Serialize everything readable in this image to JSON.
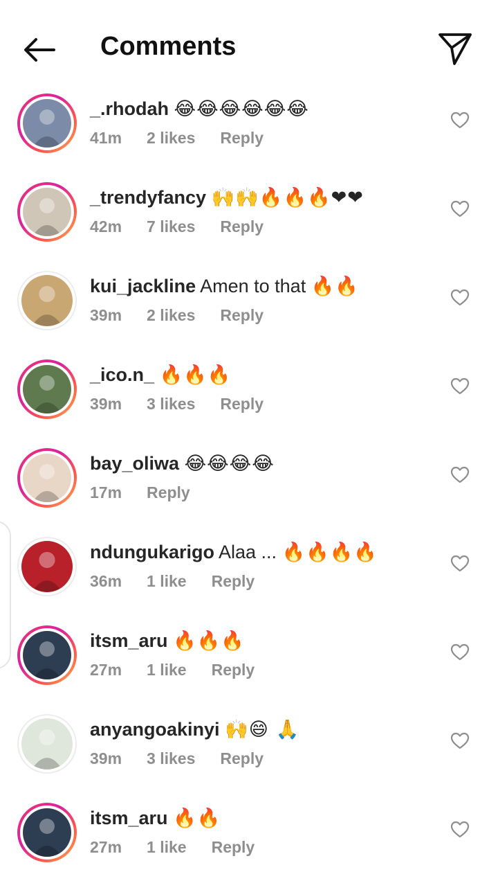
{
  "header": {
    "title": "Comments"
  },
  "comments": [
    {
      "username": "_.rhodah",
      "text": "",
      "emoji": "😂😂😂😂😂😂",
      "time": "41m",
      "likes": "2 likes",
      "reply": "Reply",
      "avatar_color": "#7b8ba8",
      "story_ring": true
    },
    {
      "username": "_trendyfancy",
      "text": "",
      "emoji": "🙌🙌🔥🔥🔥❤❤",
      "time": "42m",
      "likes": "7 likes",
      "reply": "Reply",
      "avatar_color": "#cfc6b8",
      "story_ring": true
    },
    {
      "username": "kui_jackline",
      "text": "Amen to that",
      "emoji": "🔥🔥",
      "time": "39m",
      "likes": "2 likes",
      "reply": "Reply",
      "avatar_color": "#c9a773",
      "story_ring": false
    },
    {
      "username": "_ico.n_",
      "text": "",
      "emoji": "🔥🔥🔥",
      "time": "39m",
      "likes": "3 likes",
      "reply": "Reply",
      "avatar_color": "#5f7a4e",
      "story_ring": true
    },
    {
      "username": "bay_oliwa",
      "text": "",
      "emoji": "😂😂😂😂",
      "time": "17m",
      "likes": "",
      "reply": "Reply",
      "avatar_color": "#e8d6c6",
      "story_ring": true
    },
    {
      "username": "ndungukarigo",
      "text": "Alaa ...",
      "emoji": "🔥🔥🔥🔥",
      "time": "36m",
      "likes": "1 like",
      "reply": "Reply",
      "avatar_color": "#b8202a",
      "story_ring": false
    },
    {
      "username": "itsm_aru",
      "text": "",
      "emoji": "🔥🔥🔥",
      "time": "27m",
      "likes": "1 like",
      "reply": "Reply",
      "avatar_color": "#2d3d52",
      "story_ring": true
    },
    {
      "username": "anyangoakinyi",
      "text": "",
      "emoji": "🙌😄 🙏",
      "time": "39m",
      "likes": "3 likes",
      "reply": "Reply",
      "avatar_color": "#dfe6dc",
      "story_ring": false
    },
    {
      "username": "itsm_aru",
      "text": "",
      "emoji": "🔥🔥",
      "time": "27m",
      "likes": "1 like",
      "reply": "Reply",
      "avatar_color": "#2d3d52",
      "story_ring": true
    }
  ]
}
